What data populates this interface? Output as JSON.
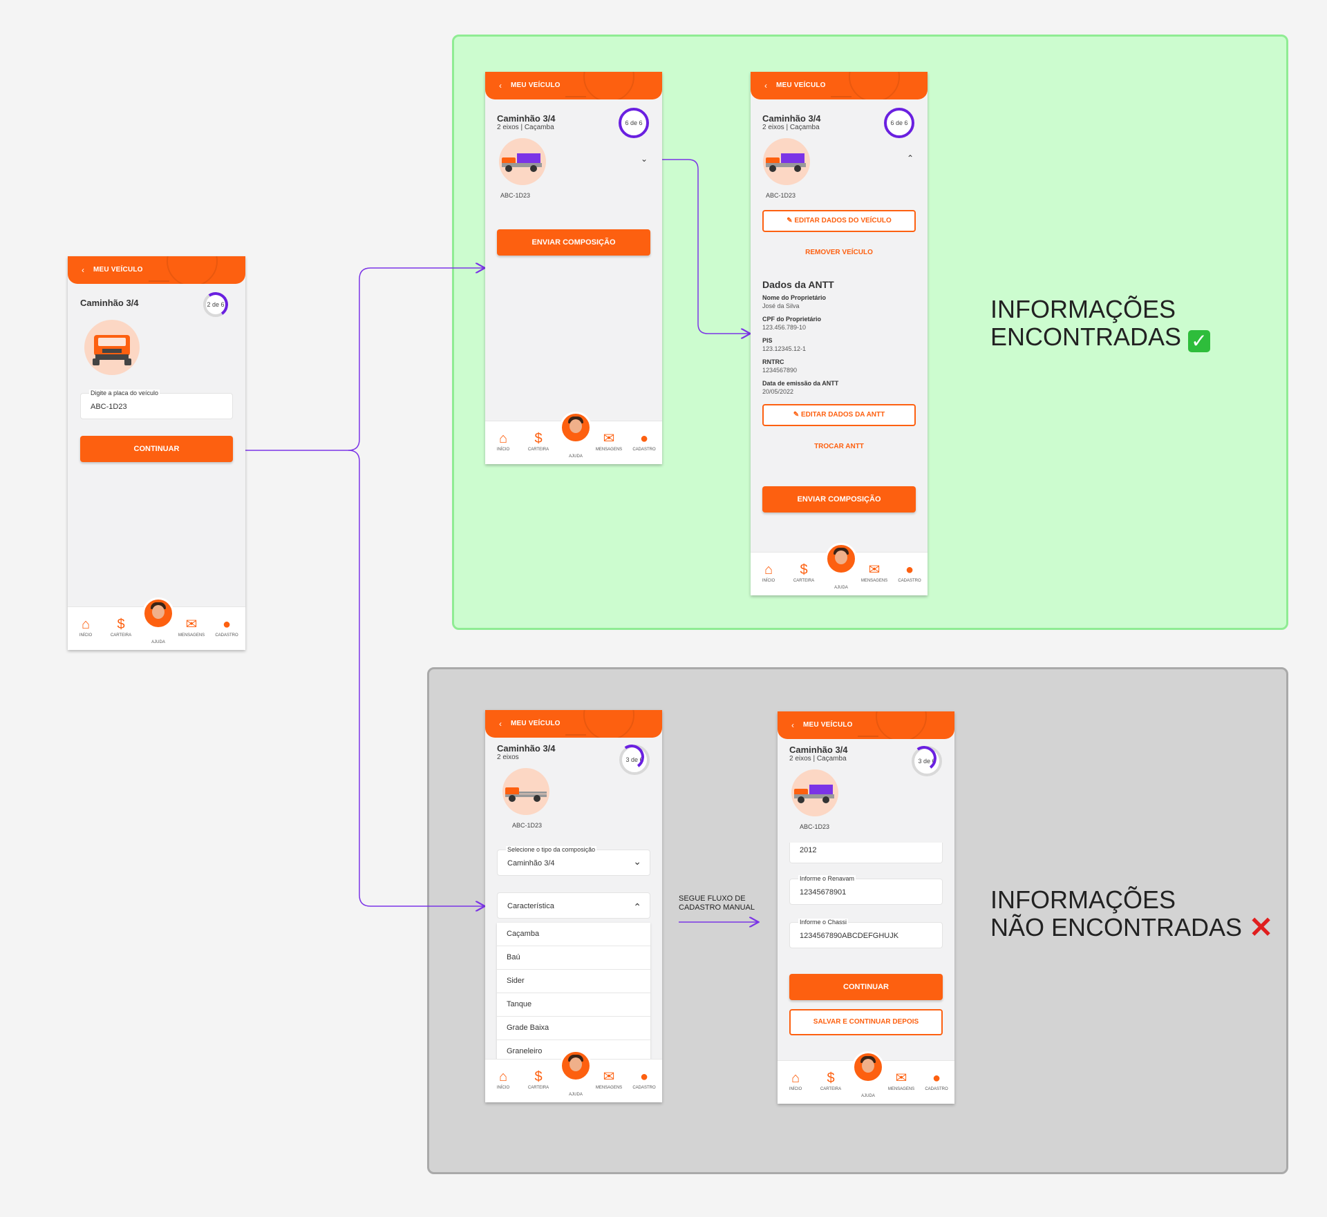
{
  "sections": {
    "found": {
      "label": "INFORMAÇÕES\nENCONTRADAS",
      "emoji": "✅"
    },
    "not_found": {
      "label": "INFORMAÇÕES\nNÃO ENCONTRADAS",
      "emoji": "❌"
    },
    "flow_note": "SEGUE FLUXO DE\nCADASTRO MANUAL"
  },
  "common": {
    "header_title": "MEU VEÍCULO",
    "back_icon": "chevron-left-icon",
    "vehicle_title": "Caminhão 3/4",
    "plate": "ABC-1D23",
    "nav": {
      "home": "INÍCIO",
      "wallet": "CARTEIRA",
      "help": "AJUDA",
      "messages": "MENSAGENS",
      "profile": "CADASTRO"
    }
  },
  "screen1": {
    "progress": "2 de 6",
    "plate_label": "Digite a placa do veículo",
    "plate_value": "ABC-1D23",
    "continue": "CONTINUAR"
  },
  "screen2": {
    "subtitle": "2 eixos | Caçamba",
    "progress": "6 de 6",
    "send": "ENVIAR COMPOSIÇÃO"
  },
  "screen3": {
    "subtitle": "2 eixos | Caçamba",
    "progress": "6 de 6",
    "edit_vehicle": "EDITAR DADOS DO VEÍCULO",
    "remove_vehicle": "REMOVER VEÍCULO",
    "antt_title": "Dados da ANTT",
    "owner_name_label": "Nome do Proprietário",
    "owner_name": "José da Silva",
    "owner_cpf_label": "CPF do Proprietário",
    "owner_cpf": "123.456.789-10",
    "pis_label": "PIS",
    "pis": "123.12345.12-1",
    "rntrc_label": "RNTRC",
    "rntrc": "1234567890",
    "antt_date_label": "Data de emissão da ANTT",
    "antt_date": "20/05/2022",
    "edit_antt": "EDITAR DADOS DA ANTT",
    "swap_antt": "TROCAR ANTT",
    "send": "ENVIAR COMPOSIÇÃO"
  },
  "screen4": {
    "subtitle": "2 eixos",
    "progress": "3 de 6",
    "composition_label": "Selecione o tipo da composição",
    "composition_value": "Caminhão 3/4",
    "feature_label": "Característica",
    "features": [
      "Caçamba",
      "Baú",
      "Sider",
      "Tanque",
      "Grade Baixa",
      "Graneleiro"
    ]
  },
  "screen5": {
    "subtitle": "2 eixos | Caçamba",
    "progress": "3 de 6",
    "year_value": "2012",
    "renavam_label": "Informe o Renavam",
    "renavam_value": "12345678901",
    "chassi_label": "Informe o Chassi",
    "chassi_value": "1234567890ABCDEFGHUJK",
    "continue": "CONTINUAR",
    "save_later": "SALVAR E CONTINUAR DEPOIS"
  },
  "colors": {
    "brand": "#fd6010",
    "accent": "#6a20e0",
    "found_bg": "#ccfccf",
    "not_found_bg": "#d3d3d3"
  }
}
